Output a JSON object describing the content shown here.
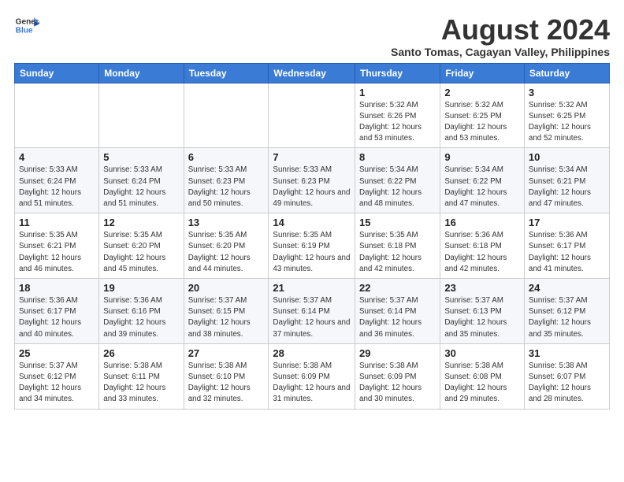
{
  "logo": {
    "line1": "General",
    "line2": "Blue"
  },
  "title": "August 2024",
  "location": "Santo Tomas, Cagayan Valley, Philippines",
  "days_of_week": [
    "Sunday",
    "Monday",
    "Tuesday",
    "Wednesday",
    "Thursday",
    "Friday",
    "Saturday"
  ],
  "weeks": [
    [
      {
        "day": "",
        "info": ""
      },
      {
        "day": "",
        "info": ""
      },
      {
        "day": "",
        "info": ""
      },
      {
        "day": "",
        "info": ""
      },
      {
        "day": "1",
        "info": "Sunrise: 5:32 AM\nSunset: 6:26 PM\nDaylight: 12 hours and 53 minutes."
      },
      {
        "day": "2",
        "info": "Sunrise: 5:32 AM\nSunset: 6:25 PM\nDaylight: 12 hours and 53 minutes."
      },
      {
        "day": "3",
        "info": "Sunrise: 5:32 AM\nSunset: 6:25 PM\nDaylight: 12 hours and 52 minutes."
      }
    ],
    [
      {
        "day": "4",
        "info": "Sunrise: 5:33 AM\nSunset: 6:24 PM\nDaylight: 12 hours and 51 minutes."
      },
      {
        "day": "5",
        "info": "Sunrise: 5:33 AM\nSunset: 6:24 PM\nDaylight: 12 hours and 51 minutes."
      },
      {
        "day": "6",
        "info": "Sunrise: 5:33 AM\nSunset: 6:23 PM\nDaylight: 12 hours and 50 minutes."
      },
      {
        "day": "7",
        "info": "Sunrise: 5:33 AM\nSunset: 6:23 PM\nDaylight: 12 hours and 49 minutes."
      },
      {
        "day": "8",
        "info": "Sunrise: 5:34 AM\nSunset: 6:22 PM\nDaylight: 12 hours and 48 minutes."
      },
      {
        "day": "9",
        "info": "Sunrise: 5:34 AM\nSunset: 6:22 PM\nDaylight: 12 hours and 47 minutes."
      },
      {
        "day": "10",
        "info": "Sunrise: 5:34 AM\nSunset: 6:21 PM\nDaylight: 12 hours and 47 minutes."
      }
    ],
    [
      {
        "day": "11",
        "info": "Sunrise: 5:35 AM\nSunset: 6:21 PM\nDaylight: 12 hours and 46 minutes."
      },
      {
        "day": "12",
        "info": "Sunrise: 5:35 AM\nSunset: 6:20 PM\nDaylight: 12 hours and 45 minutes."
      },
      {
        "day": "13",
        "info": "Sunrise: 5:35 AM\nSunset: 6:20 PM\nDaylight: 12 hours and 44 minutes."
      },
      {
        "day": "14",
        "info": "Sunrise: 5:35 AM\nSunset: 6:19 PM\nDaylight: 12 hours and 43 minutes."
      },
      {
        "day": "15",
        "info": "Sunrise: 5:35 AM\nSunset: 6:18 PM\nDaylight: 12 hours and 42 minutes."
      },
      {
        "day": "16",
        "info": "Sunrise: 5:36 AM\nSunset: 6:18 PM\nDaylight: 12 hours and 42 minutes."
      },
      {
        "day": "17",
        "info": "Sunrise: 5:36 AM\nSunset: 6:17 PM\nDaylight: 12 hours and 41 minutes."
      }
    ],
    [
      {
        "day": "18",
        "info": "Sunrise: 5:36 AM\nSunset: 6:17 PM\nDaylight: 12 hours and 40 minutes."
      },
      {
        "day": "19",
        "info": "Sunrise: 5:36 AM\nSunset: 6:16 PM\nDaylight: 12 hours and 39 minutes."
      },
      {
        "day": "20",
        "info": "Sunrise: 5:37 AM\nSunset: 6:15 PM\nDaylight: 12 hours and 38 minutes."
      },
      {
        "day": "21",
        "info": "Sunrise: 5:37 AM\nSunset: 6:14 PM\nDaylight: 12 hours and 37 minutes."
      },
      {
        "day": "22",
        "info": "Sunrise: 5:37 AM\nSunset: 6:14 PM\nDaylight: 12 hours and 36 minutes."
      },
      {
        "day": "23",
        "info": "Sunrise: 5:37 AM\nSunset: 6:13 PM\nDaylight: 12 hours and 35 minutes."
      },
      {
        "day": "24",
        "info": "Sunrise: 5:37 AM\nSunset: 6:12 PM\nDaylight: 12 hours and 35 minutes."
      }
    ],
    [
      {
        "day": "25",
        "info": "Sunrise: 5:37 AM\nSunset: 6:12 PM\nDaylight: 12 hours and 34 minutes."
      },
      {
        "day": "26",
        "info": "Sunrise: 5:38 AM\nSunset: 6:11 PM\nDaylight: 12 hours and 33 minutes."
      },
      {
        "day": "27",
        "info": "Sunrise: 5:38 AM\nSunset: 6:10 PM\nDaylight: 12 hours and 32 minutes."
      },
      {
        "day": "28",
        "info": "Sunrise: 5:38 AM\nSunset: 6:09 PM\nDaylight: 12 hours and 31 minutes."
      },
      {
        "day": "29",
        "info": "Sunrise: 5:38 AM\nSunset: 6:09 PM\nDaylight: 12 hours and 30 minutes."
      },
      {
        "day": "30",
        "info": "Sunrise: 5:38 AM\nSunset: 6:08 PM\nDaylight: 12 hours and 29 minutes."
      },
      {
        "day": "31",
        "info": "Sunrise: 5:38 AM\nSunset: 6:07 PM\nDaylight: 12 hours and 28 minutes."
      }
    ]
  ]
}
